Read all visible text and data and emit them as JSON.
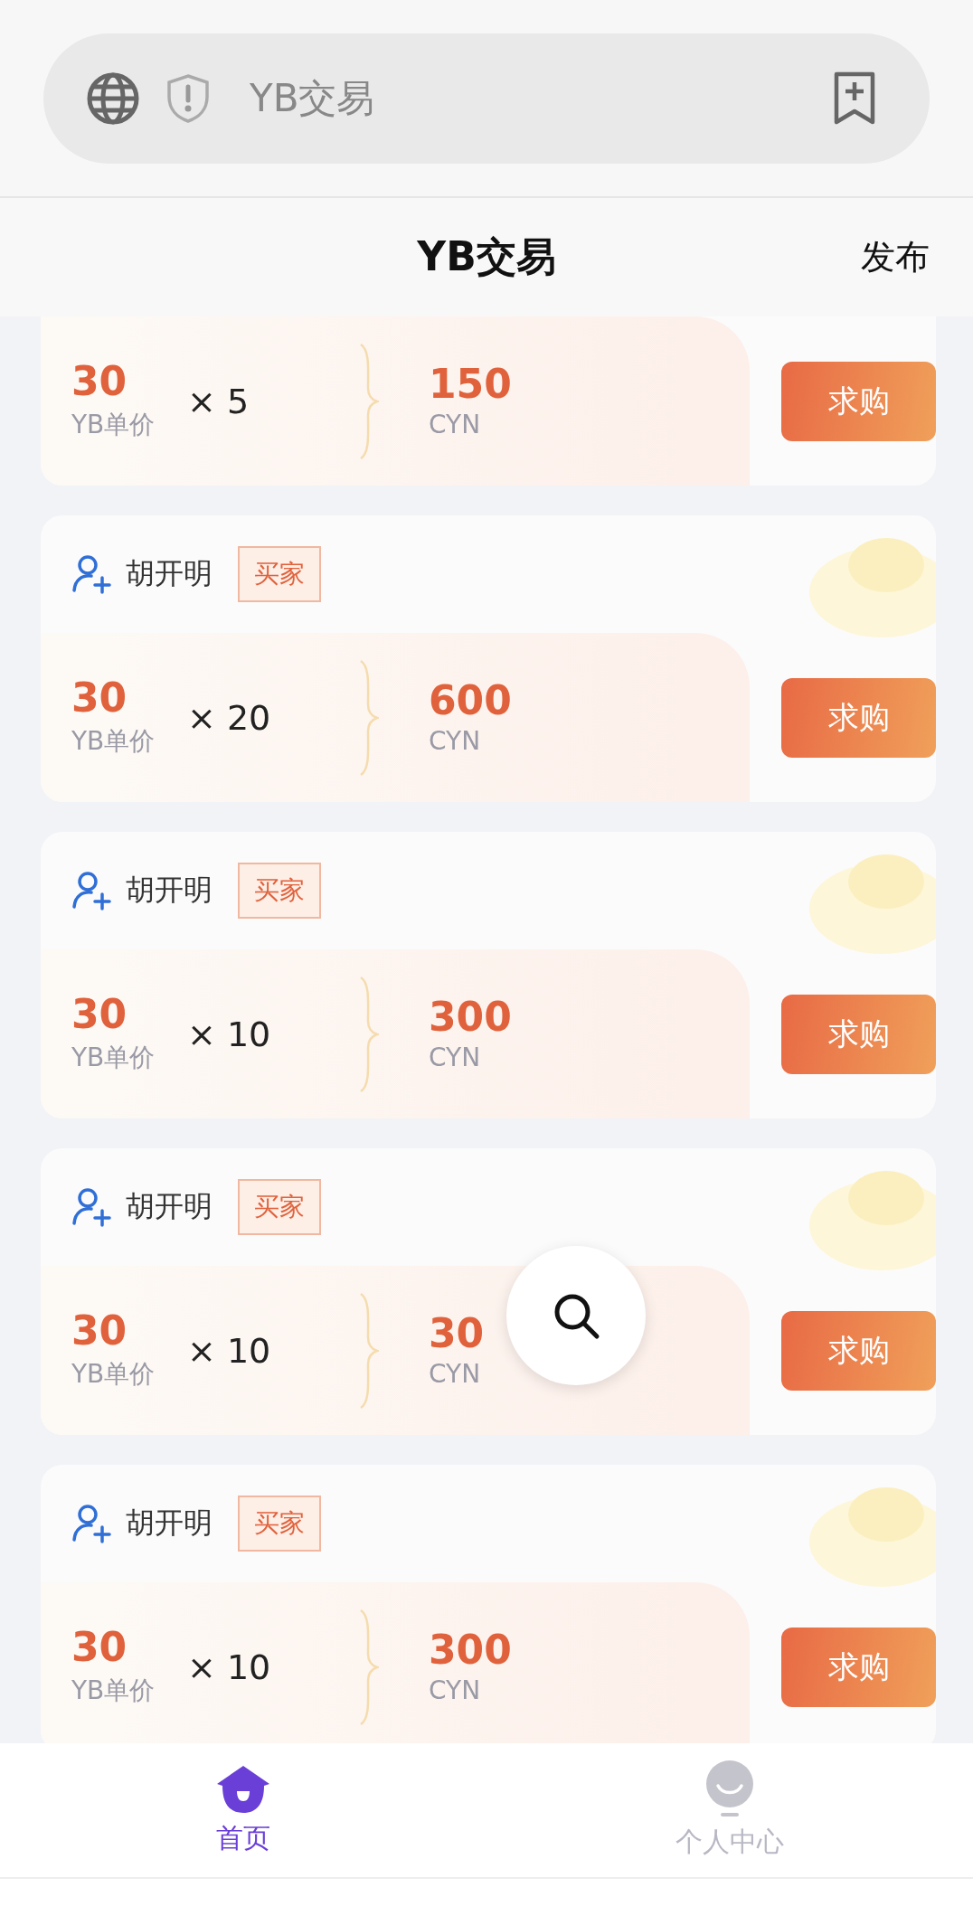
{
  "browser": {
    "address": "YB交易"
  },
  "header": {
    "title": "YB交易",
    "action": "发布"
  },
  "listings": [
    {
      "kind": "partial",
      "price": "30",
      "price_label": "YB单价",
      "quantity": "× 5",
      "total": "150",
      "currency": "CYN",
      "button": "求购"
    },
    {
      "kind": "full",
      "user": "胡开明",
      "role": "买家",
      "price": "30",
      "price_label": "YB单价",
      "quantity": "× 20",
      "total": "600",
      "currency": "CYN",
      "button": "求购"
    },
    {
      "kind": "full",
      "user": "胡开明",
      "role": "买家",
      "price": "30",
      "price_label": "YB单价",
      "quantity": "× 10",
      "total": "300",
      "currency": "CYN",
      "button": "求购"
    },
    {
      "kind": "full",
      "user": "胡开明",
      "role": "买家",
      "price": "30",
      "price_label": "YB单价",
      "quantity": "× 10",
      "total": "30",
      "currency": "CYN",
      "button": "求购"
    },
    {
      "kind": "full",
      "user": "胡开明",
      "role": "买家",
      "price": "30",
      "price_label": "YB单价",
      "quantity": "× 10",
      "total": "300",
      "currency": "CYN",
      "button": "求购"
    }
  ],
  "nav": [
    {
      "kind": "home",
      "label": "首页",
      "selected": true
    },
    {
      "kind": "profile",
      "label": "个人中心",
      "selected": false
    }
  ]
}
